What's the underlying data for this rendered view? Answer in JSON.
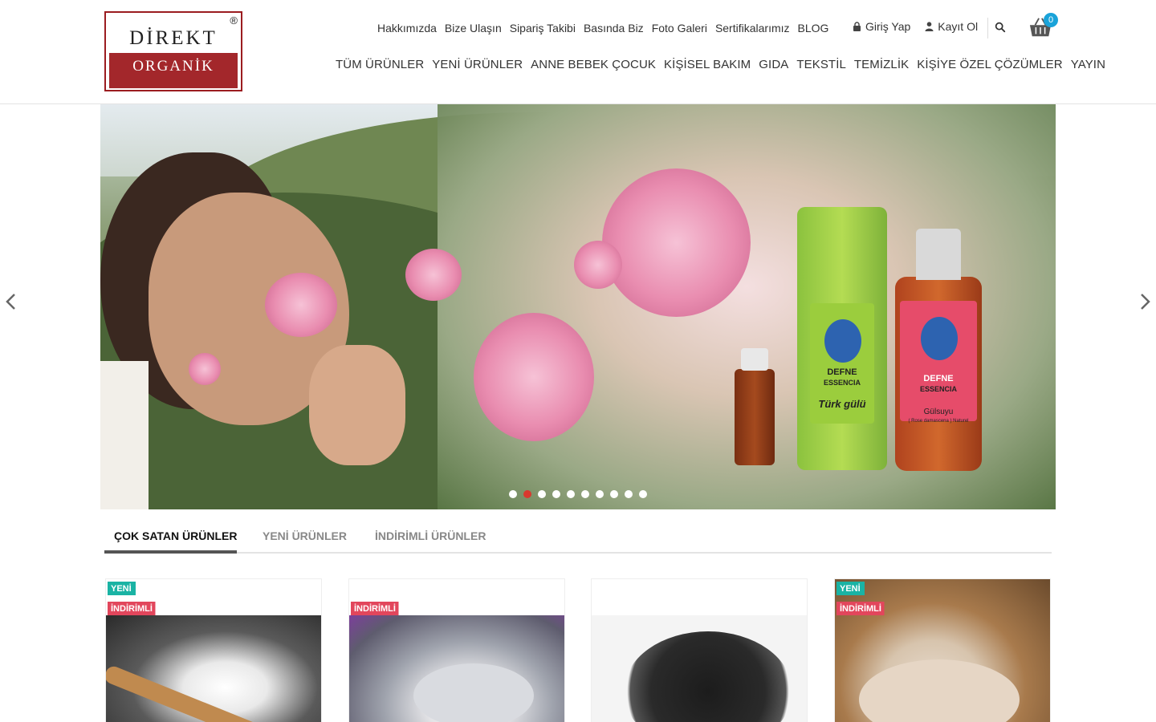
{
  "brand": {
    "line1": "DİREKT",
    "line2": "ORGANİK",
    "registered": "®",
    "colors": {
      "primary": "#a3272b",
      "accent": "#1aa3d9"
    }
  },
  "topnav": [
    "Hakkımızda",
    "Bize Ulaşın",
    "Sipariş Takibi",
    "Basında Biz",
    "Foto Galeri",
    "Sertifikalarımız",
    "BLOG"
  ],
  "user": {
    "login": {
      "label": "Giriş Yap",
      "icon": "lock-icon"
    },
    "register": {
      "label": "Kayıt Ol",
      "icon": "user-icon"
    }
  },
  "cart": {
    "count": "0",
    "icon": "basket-icon"
  },
  "mainnav": [
    "TÜM ÜRÜNLER",
    "YENİ ÜRÜNLER",
    "ANNE BEBEK ÇOCUK",
    "KİŞİSEL BAKIM",
    "GIDA",
    "TEKSTİL",
    "TEMİZLİK",
    "KİŞİYE ÖZEL ÇÖZÜMLER",
    "YAYIN"
  ],
  "slider": {
    "slide_count": 10,
    "active_slide": 2,
    "bottle_brand_1": "DEFNE",
    "bottle_sub_1": "ESSENCIA",
    "bottle_name_1": "Türk gülü",
    "bottle_brand_2": "DEFNE",
    "bottle_sub_2": "ESSENCIA",
    "bottle_name_2": "Gülsuyu",
    "bottle_desc_2": "( Rose damascena ) Naturel"
  },
  "tabs": [
    "ÇOK SATAN ÜRÜNLER",
    "YENİ ÜRÜNLER",
    "İNDİRİMLİ ÜRÜNLER"
  ],
  "active_tab": "ÇOK SATAN ÜRÜNLER",
  "products": [
    {
      "badges": [
        "YENİ",
        "İNDİRİMLİ"
      ]
    },
    {
      "badges": [
        "İNDİRİMLİ"
      ]
    },
    {
      "badges": []
    },
    {
      "badges": [
        "YENİ",
        "İNDİRİMLİ"
      ]
    }
  ]
}
